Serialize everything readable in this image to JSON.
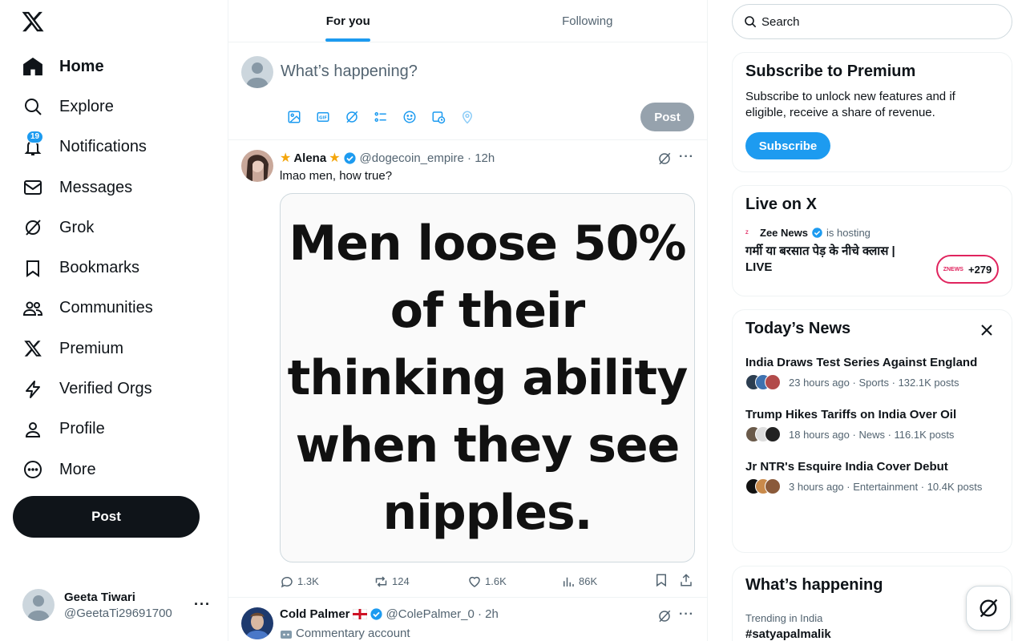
{
  "sidebar": {
    "nav": [
      {
        "label": "Home",
        "icon": "home-icon"
      },
      {
        "label": "Explore",
        "icon": "search-icon"
      },
      {
        "label": "Notifications",
        "icon": "bell-icon",
        "badge": "19"
      },
      {
        "label": "Messages",
        "icon": "mail-icon"
      },
      {
        "label": "Grok",
        "icon": "grok-icon"
      },
      {
        "label": "Bookmarks",
        "icon": "bookmark-icon"
      },
      {
        "label": "Communities",
        "icon": "communities-icon"
      },
      {
        "label": "Premium",
        "icon": "x-logo-icon"
      },
      {
        "label": "Verified Orgs",
        "icon": "lightning-icon"
      },
      {
        "label": "Profile",
        "icon": "person-icon"
      },
      {
        "label": "More",
        "icon": "more-circle-icon"
      }
    ],
    "post_label": "Post",
    "account": {
      "name": "Geeta Tiwari",
      "handle": "@GeetaTi29691700"
    }
  },
  "tabs": [
    {
      "label": "For you",
      "active": true
    },
    {
      "label": "Following",
      "active": false
    }
  ],
  "compose": {
    "placeholder": "What’s happening?",
    "post_label": "Post"
  },
  "tweets": [
    {
      "name": "Alena",
      "handle": "@dogecoin_empire",
      "time": "12h",
      "text": "lmao men, how true?",
      "image_text": "Men loose 50%\nof their\nthinking ability\nwhen they see\nnipples.",
      "replies": "1.3K",
      "reposts": "124",
      "likes": "1.6K",
      "views": "86K"
    },
    {
      "name": "Cold Palmer",
      "handle": "@ColePalmer_0",
      "time": "2h",
      "text": "Commentary account"
    }
  ],
  "search": {
    "placeholder": "Search"
  },
  "premium": {
    "title": "Subscribe to Premium",
    "text": "Subscribe to unlock new features and if eligible, receive a share of revenue.",
    "button": "Subscribe"
  },
  "live": {
    "title": "Live on X",
    "host": "Zee News",
    "hosting": "is hosting",
    "show": "गर्मी या बरसात पेड़ के नीचे क्लास | LIVE",
    "count": "+279",
    "brand": "ZNEWS"
  },
  "news": {
    "title": "Today’s News",
    "items": [
      {
        "title": "India Draws Test Series Against England",
        "meta": "23 hours ago · Sports · 132.1K posts"
      },
      {
        "title": "Trump Hikes Tariffs on India Over Oil",
        "meta": "18 hours ago · News · 116.1K posts"
      },
      {
        "title": "Jr NTR's Esquire India Cover Debut",
        "meta": "3 hours ago · Entertainment · 10.4K posts"
      }
    ]
  },
  "happening": {
    "title": "What’s happening",
    "label": "Trending in India",
    "tag": "#satyapalmalik"
  },
  "colors": {
    "accent": "#1d9bf0",
    "text": "#0f1419",
    "muted": "#536471",
    "border": "#eff3f4",
    "live": "#e0245e"
  }
}
